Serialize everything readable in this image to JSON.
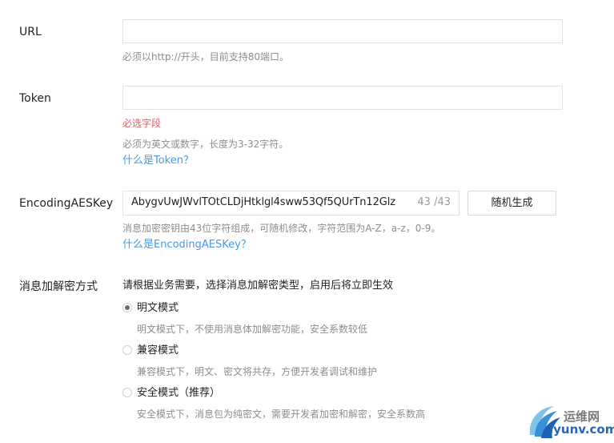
{
  "url": {
    "label": "URL",
    "value": "",
    "help": "必须以http://开头，目前支持80端口。"
  },
  "token": {
    "label": "Token",
    "value": "",
    "required_msg": "必选字段",
    "help": "必须为英文或数字，长度为3-32字符。",
    "link": "什么是Token？"
  },
  "aes": {
    "label": "EncodingAESKey",
    "value": "AbygvUwJWvlTOtCLDjHtklgl4sww53Qf5QUrTn12Glz",
    "count": "43 /43",
    "button": "随机生成",
    "help": "消息加密密钥由43位字符组成，可随机修改，字符范围为A-Z，a-z，0-9。",
    "link": "什么是EncodingAESKey？"
  },
  "mode": {
    "label": "消息加解密方式",
    "intro": "请根据业务需要，选择消息加解密类型，启用后将立即生效",
    "options": [
      {
        "label": "明文模式",
        "desc": "明文模式下，不使用消息体加解密功能，安全系数较低",
        "checked": true
      },
      {
        "label": "兼容模式",
        "desc": "兼容模式下，明文、密文将共存，方便开发者调试和维护",
        "checked": false
      },
      {
        "label": "安全模式（推荐）",
        "desc": "安全模式下，消息包为纯密文，需要开发者加密和解密，安全系数高",
        "checked": false
      }
    ]
  },
  "watermark": {
    "cn": "运维网",
    "en": "iyunv.com",
    "icon": "swoosh-logo-icon"
  },
  "colors": {
    "link": "#459ae9",
    "required": "#e15f63",
    "help": "#8d8d8d",
    "border": "#e1e1e1"
  }
}
